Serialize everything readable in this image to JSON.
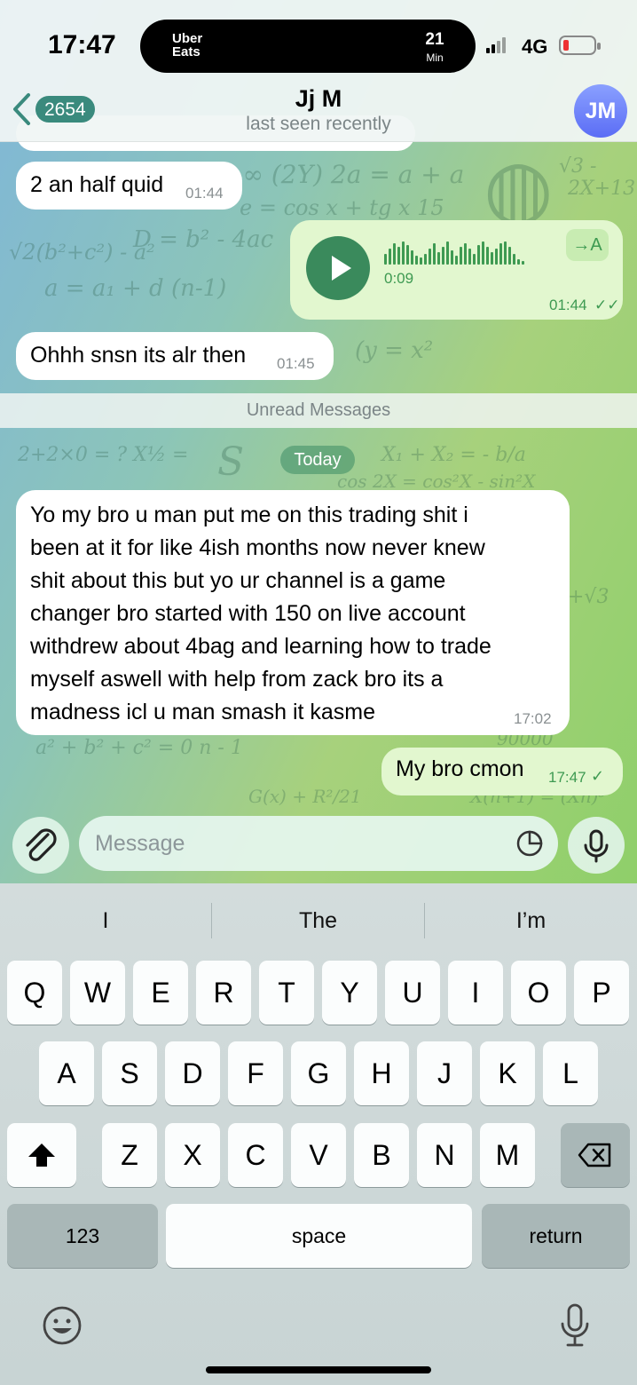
{
  "status_bar": {
    "time": "17:47",
    "live_activity_brand_line1": "Uber",
    "live_activity_brand_line2": "Eats",
    "live_activity_value": "21",
    "live_activity_unit": "Min",
    "network": "4G",
    "battery_color": "#e33333"
  },
  "header": {
    "back_count": "2654",
    "contact_name": "Jj M",
    "contact_status": "last seen recently",
    "avatar_initials": "JM",
    "accent_color": "#3a8a7d"
  },
  "messages": [
    {
      "type": "text",
      "direction": "incoming",
      "text": "2 an half quid",
      "time": "01:44"
    },
    {
      "type": "voice",
      "direction": "outgoing",
      "duration": "0:09",
      "transcribe_label": "→A",
      "time": "01:44",
      "status": "read"
    },
    {
      "type": "text",
      "direction": "incoming",
      "text": "Ohhh snsn its alr then",
      "time": "01:45"
    }
  ],
  "unread_label": "Unread Messages",
  "date_separator": "Today",
  "long_message": {
    "direction": "incoming",
    "lines": [
      "Yo my bro u man put me on this trading shit i",
      "been at it for like 4ish months now never knew",
      "shit about this but yo ur channel is a game",
      "changer bro started with 150 on live account",
      "withdrew about 4bag and learning how to trade",
      "myself aswell with help from zack bro its a",
      "madness icl u man smash it kasme"
    ],
    "time": "17:02"
  },
  "reply_message": {
    "direction": "outgoing",
    "text": "My bro cmon",
    "time": "17:47",
    "status": "sent"
  },
  "composer": {
    "placeholder": "Message",
    "attach_icon": "paperclip-icon",
    "sticker_icon": "sticker-icon",
    "mic_icon": "microphone-icon"
  },
  "keyboard": {
    "suggestions": [
      "I",
      "The",
      "I’m"
    ],
    "row1": [
      "Q",
      "W",
      "E",
      "R",
      "T",
      "Y",
      "U",
      "I",
      "O",
      "P"
    ],
    "row2": [
      "A",
      "S",
      "D",
      "F",
      "G",
      "H",
      "J",
      "K",
      "L"
    ],
    "row3": [
      "Z",
      "X",
      "C",
      "V",
      "B",
      "N",
      "M"
    ],
    "numbers_label": "123",
    "space_label": "space",
    "return_label": "return",
    "shift_icon": "shift-icon",
    "delete_icon": "delete-icon",
    "emoji_icon": "emoji-icon",
    "dictation_icon": "microphone-icon"
  }
}
